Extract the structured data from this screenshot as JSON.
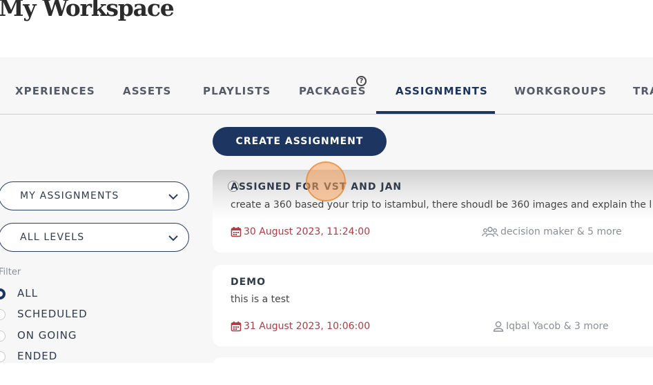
{
  "page": {
    "title": "My Workspace"
  },
  "tabs": [
    {
      "label": "XPERIENCES"
    },
    {
      "label": "ASSETS"
    },
    {
      "label": "PLAYLISTS"
    },
    {
      "label": "PACKAGES"
    },
    {
      "label": "ASSIGNMENTS",
      "active": true
    },
    {
      "label": "WORKGROUPS"
    },
    {
      "label": "TRA"
    }
  ],
  "help_icon": {
    "glyph": "?"
  },
  "toolbar": {
    "create_label": "CREATE ASSIGNMENT"
  },
  "filters": {
    "scope_select": {
      "value": "MY ASSIGNMENTS"
    },
    "level_select": {
      "value": "ALL LEVELS"
    },
    "label": "Filter",
    "options": [
      {
        "label": "ALL",
        "checked": true
      },
      {
        "label": "SCHEDULED",
        "checked": false
      },
      {
        "label": "ON GOING",
        "checked": false
      },
      {
        "label": "ENDED",
        "checked": false
      }
    ]
  },
  "assignments": [
    {
      "title": "ASSIGNED FOR VST AND JAN",
      "description": "create a 360 based your trip to istambul, there shoudl be 360 images and explain the l",
      "date": "30 August 2023, 11:24:00",
      "people": "decision maker & 5 more",
      "people_icon": "group-icon"
    },
    {
      "title": "DEMO",
      "description": "this is a test",
      "date": "31 August 2023, 10:06:00",
      "people": "Iqbal Yacob & 3 more",
      "people_icon": "user-icon"
    }
  ],
  "colors": {
    "primary": "#1c3661",
    "date": "#b03a44",
    "panel": "#f7f7f7"
  }
}
